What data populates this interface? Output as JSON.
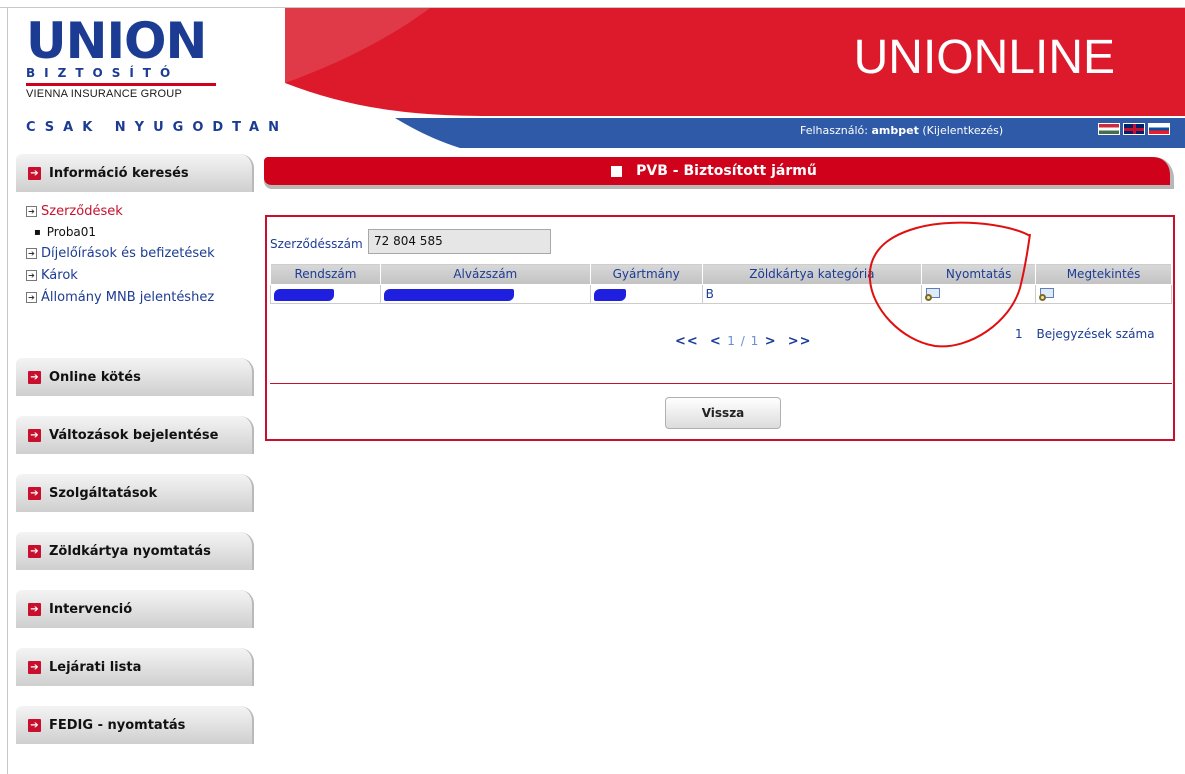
{
  "logo": {
    "union": "UNION",
    "biztosito": "BIZTOSÍTÓ",
    "group": "VIENNA INSURANCE GROUP"
  },
  "tagline": "CSAK NYUGODTAN",
  "brand": "UNIONLINE",
  "user": {
    "prefix": "Felhasználó:",
    "name": "ambpet",
    "logout": "(Kijelentkezés)"
  },
  "flags": [
    "flag-hu-icon",
    "flag-uk-icon",
    "flag-sk-icon"
  ],
  "sidebar": {
    "search_header": "Információ keresés",
    "links": {
      "contracts": "Szerződések",
      "proba": "Proba01",
      "premiums": "Díjelőírások és befizetések",
      "claims": "Károk",
      "mnb": "Állomány MNB jelentéshez"
    },
    "menu": [
      "Online kötés",
      "Változások bejelentése",
      "Szolgáltatások",
      "Zöldkártya nyomtatás",
      "Intervenció",
      "Lejárati lista",
      "FEDIG - nyomtatás"
    ]
  },
  "page": {
    "title": "PVB - Biztosított jármű",
    "contract_label": "Szerződésszám",
    "contract_value": "72 804 585"
  },
  "table": {
    "headers": [
      "Rendszám",
      "Alvázszám",
      "Gyártmány",
      "Zöldkártya kategória",
      "Nyomtatás",
      "Megtekintés"
    ],
    "row": {
      "category": "B"
    }
  },
  "pager": {
    "first": "<<",
    "prev": "<",
    "page": "1 / 1",
    "next": ">",
    "last": ">>"
  },
  "records": {
    "count": "1",
    "label": "Bejegyzések száma"
  },
  "back_button": "Vissza",
  "colors": {
    "red": "#c8102e",
    "blue": "#1c3c94",
    "header_blue": "#2e5aa8"
  }
}
